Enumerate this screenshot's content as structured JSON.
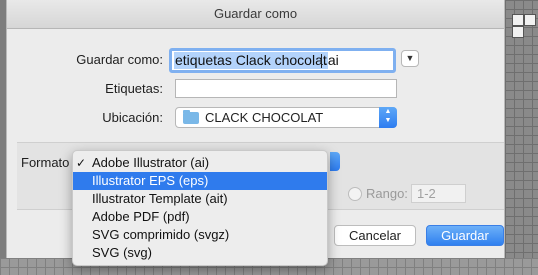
{
  "dialog": {
    "title": "Guardar como"
  },
  "fields": {
    "save_as_label": "Guardar como:",
    "filename_selected": "etiquetas Clack chocolat",
    "filename_ext": ".ai",
    "tags_label": "Etiquetas:",
    "tags_value": "",
    "location_label": "Ubicación:",
    "location_value": "CLACK CHOCOLAT"
  },
  "format": {
    "label": "Formato",
    "options": [
      {
        "label": "Adobe Illustrator (ai)",
        "checked": true,
        "highlighted": false
      },
      {
        "label": "Illustrator EPS (eps)",
        "checked": false,
        "highlighted": true
      },
      {
        "label": "Illustrator Template (ait)",
        "checked": false,
        "highlighted": false
      },
      {
        "label": "Adobe PDF (pdf)",
        "checked": false,
        "highlighted": false
      },
      {
        "label": "SVG comprimido (svgz)",
        "checked": false,
        "highlighted": false
      },
      {
        "label": "SVG (svg)",
        "checked": false,
        "highlighted": false
      }
    ],
    "check_glyph": "✓"
  },
  "range": {
    "label": "Rango:",
    "value": "1-2"
  },
  "buttons": {
    "cancel": "Cancelar",
    "save": "Guardar"
  },
  "colors": {
    "accent": "#2f7bed",
    "selection": "#b3d3fb",
    "folder": "#7ab8e8"
  },
  "icons": {
    "expand": "chevron-down-icon",
    "folder": "folder-icon",
    "stepper": "up-down-chevron-icon"
  }
}
